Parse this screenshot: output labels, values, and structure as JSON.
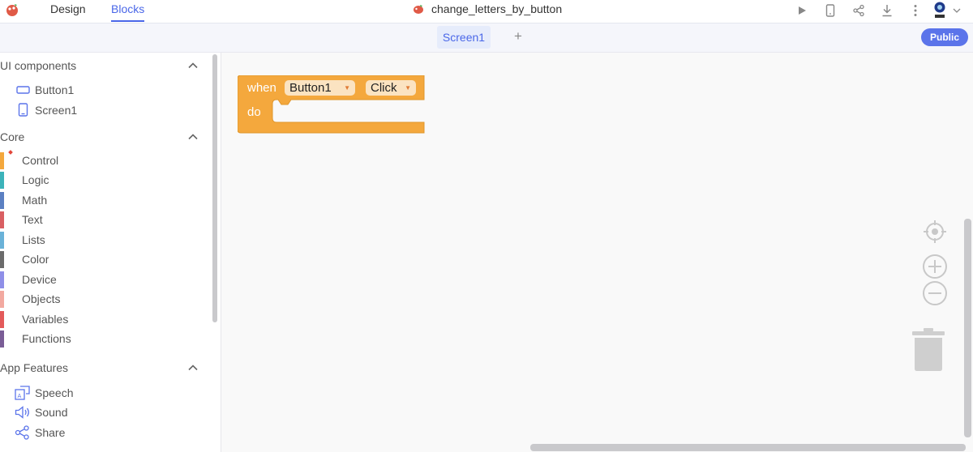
{
  "topbar": {
    "tabs": [
      {
        "label": "Design",
        "active": false
      },
      {
        "label": "Blocks",
        "active": true
      }
    ],
    "project_name": "change_letters_by_button",
    "icons": [
      "play-icon",
      "phone-icon",
      "share-icon",
      "download-icon",
      "more-vert-icon",
      "avatar-icon",
      "chevron-down-icon"
    ],
    "accent": "#4a67e8"
  },
  "screenbar": {
    "active_screen": "Screen1",
    "add_label": "+",
    "public_label": "Public"
  },
  "sidebar": {
    "ui_components": {
      "title": "UI components",
      "items": [
        {
          "label": "Button1",
          "icon": "button-icon"
        },
        {
          "label": "Screen1",
          "icon": "screen-icon"
        }
      ]
    },
    "core": {
      "title": "Core",
      "items": [
        {
          "label": "Control",
          "color": "#f4a83d"
        },
        {
          "label": "Logic",
          "color": "#3cb3ba"
        },
        {
          "label": "Math",
          "color": "#5b80c2"
        },
        {
          "label": "Text",
          "color": "#d95f62"
        },
        {
          "label": "Lists",
          "color": "#6ab2d8"
        },
        {
          "label": "Color",
          "color": "#6b6b6b"
        },
        {
          "label": "Device",
          "color": "#8f8fe8"
        },
        {
          "label": "Objects",
          "color": "#f2a9a0"
        },
        {
          "label": "Variables",
          "color": "#e35a5a"
        },
        {
          "label": "Functions",
          "color": "#7a5d96"
        }
      ]
    },
    "app_features": {
      "title": "App Features",
      "items": [
        {
          "label": "Speech",
          "icon": "speech-icon"
        },
        {
          "label": "Sound",
          "icon": "sound-icon"
        },
        {
          "label": "Share",
          "icon": "share-icon"
        }
      ]
    }
  },
  "workspace": {
    "event_block": {
      "when_label": "when",
      "component": "Button1",
      "event": "Click",
      "do_label": "do",
      "color": "#f4a83d"
    },
    "controls": [
      "recenter-icon",
      "zoom-in-icon",
      "zoom-out-icon",
      "trash-icon"
    ]
  }
}
